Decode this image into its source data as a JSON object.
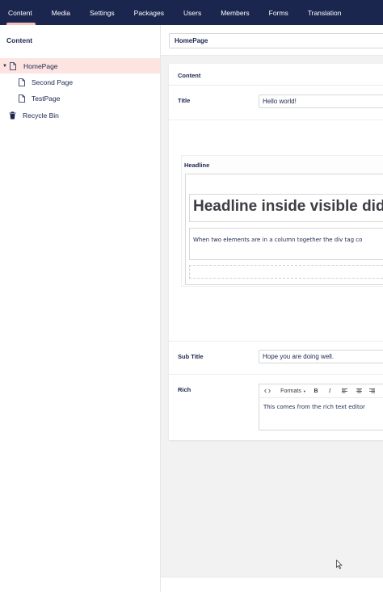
{
  "nav": {
    "items": [
      "Content",
      "Media",
      "Settings",
      "Packages",
      "Users",
      "Members",
      "Forms",
      "Translation"
    ],
    "active_index": 0,
    "active_color": "#f5c1bc",
    "background": "#1b264f"
  },
  "sidebar": {
    "title": "Content",
    "tree": [
      {
        "label": "HomePage",
        "icon": "document-icon",
        "selected": true,
        "expanded": true
      },
      {
        "label": "Second Page",
        "icon": "document-icon"
      },
      {
        "label": "TestPage",
        "icon": "document-icon"
      },
      {
        "label": "Recycle Bin",
        "icon": "trash-icon"
      }
    ]
  },
  "editor": {
    "node_name": "HomePage",
    "tab_label": "Content",
    "title": {
      "label": "Title",
      "value": "Hello world!"
    },
    "headline": {
      "label": "Headline",
      "heading_text": "Headline inside visible didv",
      "paragraph_text": "When two elements are in a column together the div tag co"
    },
    "subtitle": {
      "label": "Sub Title",
      "value": "Hope you are doing well."
    },
    "rich": {
      "label": "Rich",
      "toolbar": {
        "source_icon": "code-icon",
        "formats_label": "Formats",
        "formats_caret_icon": "caret-down-icon",
        "bold_label": "B",
        "italic_label": "I",
        "align_icons": [
          "align-left-icon",
          "align-center-icon",
          "align-right-icon"
        ]
      },
      "content": "This comes from the rich text editor"
    }
  },
  "colors": {
    "selected_row": "#fde4e1",
    "text": "#1b264f"
  }
}
